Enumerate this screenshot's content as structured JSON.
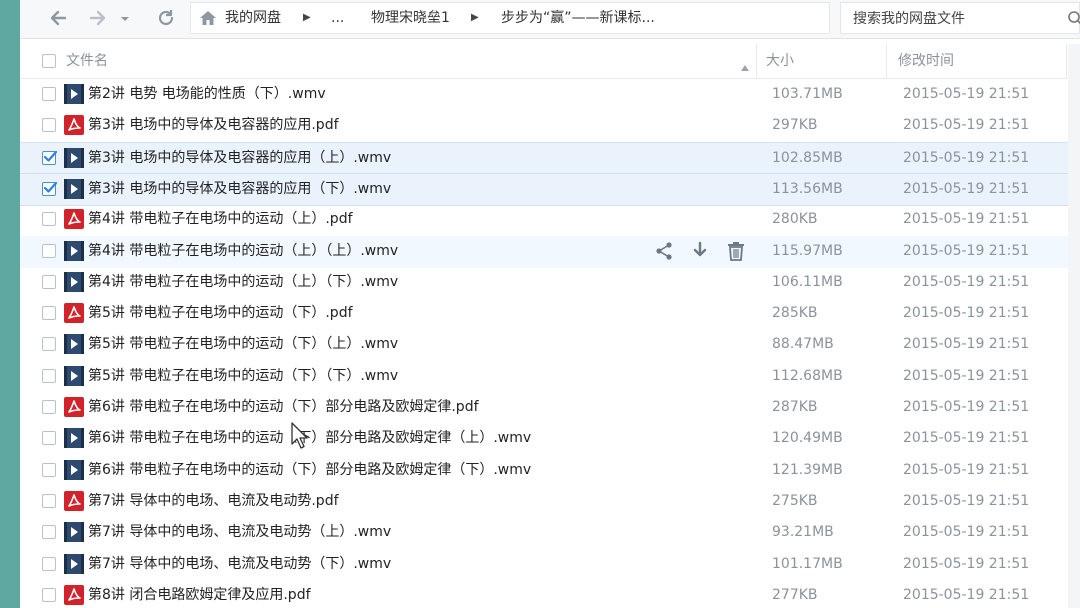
{
  "toolbar": {
    "breadcrumbs": [
      "我的网盘",
      "...",
      "物理宋晓垒1",
      "步步为“赢”——新课标..."
    ],
    "search_placeholder": "搜索我的网盘文件"
  },
  "columns": {
    "name": "文件名",
    "size": "大小",
    "modified": "修改时间"
  },
  "files": [
    {
      "type": "wmv",
      "name": "第2讲 电势  电场能的性质（下）.wmv",
      "size": "103.71MB",
      "date": "2015-05-19 21:51",
      "checked": false
    },
    {
      "type": "pdf",
      "name": "第3讲 电场中的导体及电容器的应用.pdf",
      "size": "297KB",
      "date": "2015-05-19 21:51",
      "checked": false
    },
    {
      "type": "wmv",
      "name": "第3讲 电场中的导体及电容器的应用（上）.wmv",
      "size": "102.85MB",
      "date": "2015-05-19 21:51",
      "checked": true
    },
    {
      "type": "wmv",
      "name": "第3讲 电场中的导体及电容器的应用（下）.wmv",
      "size": "113.56MB",
      "date": "2015-05-19 21:51",
      "checked": true
    },
    {
      "type": "pdf",
      "name": "第4讲 带电粒子在电场中的运动（上）.pdf",
      "size": "280KB",
      "date": "2015-05-19 21:51",
      "checked": false
    },
    {
      "type": "wmv",
      "name": "第4讲 带电粒子在电场中的运动（上）（上）.wmv",
      "size": "115.97MB",
      "date": "2015-05-19 21:51",
      "checked": false,
      "hover": true
    },
    {
      "type": "wmv",
      "name": "第4讲 带电粒子在电场中的运动（上）（下）.wmv",
      "size": "106.11MB",
      "date": "2015-05-19 21:51",
      "checked": false
    },
    {
      "type": "pdf",
      "name": "第5讲 带电粒子在电场中的运动（下）.pdf",
      "size": "285KB",
      "date": "2015-05-19 21:51",
      "checked": false
    },
    {
      "type": "wmv",
      "name": "第5讲 带电粒子在电场中的运动（下）（上）.wmv",
      "size": "88.47MB",
      "date": "2015-05-19 21:51",
      "checked": false
    },
    {
      "type": "wmv",
      "name": "第5讲 带电粒子在电场中的运动（下）（下）.wmv",
      "size": "112.68MB",
      "date": "2015-05-19 21:51",
      "checked": false
    },
    {
      "type": "pdf",
      "name": "第6讲 带电粒子在电场中的运动（下）部分电路及欧姆定律.pdf",
      "size": "287KB",
      "date": "2015-05-19 21:51",
      "checked": false
    },
    {
      "type": "wmv",
      "name": "第6讲 带电粒子在电场中的运动（下）部分电路及欧姆定律（上）.wmv",
      "size": "120.49MB",
      "date": "2015-05-19 21:51",
      "checked": false
    },
    {
      "type": "wmv",
      "name": "第6讲 带电粒子在电场中的运动（下）部分电路及欧姆定律（下）.wmv",
      "size": "121.39MB",
      "date": "2015-05-19 21:51",
      "checked": false
    },
    {
      "type": "pdf",
      "name": "第7讲 导体中的电场、电流及电动势.pdf",
      "size": "275KB",
      "date": "2015-05-19 21:51",
      "checked": false
    },
    {
      "type": "wmv",
      "name": "第7讲 导体中的电场、电流及电动势（上）.wmv",
      "size": "93.21MB",
      "date": "2015-05-19 21:51",
      "checked": false
    },
    {
      "type": "wmv",
      "name": "第7讲 导体中的电场、电流及电动势（下）.wmv",
      "size": "101.17MB",
      "date": "2015-05-19 21:51",
      "checked": false
    },
    {
      "type": "pdf",
      "name": "第8讲 闭合电路欧姆定律及应用.pdf",
      "size": "277KB",
      "date": "2015-05-19 21:51",
      "checked": false
    }
  ],
  "icons": {
    "back": "arrow-left-icon",
    "forward": "arrow-right-icon",
    "dropdown": "chevron-down-icon",
    "refresh": "refresh-icon",
    "home": "home-icon",
    "search": "search-icon",
    "share": "share-icon",
    "download": "download-icon",
    "delete": "trash-icon",
    "video": "video-file-icon",
    "pdf": "pdf-file-icon"
  },
  "colors": {
    "selected_bg": "#eaf3fc",
    "hover_bg": "#f2f8ff",
    "pdf_red": "#d2232a",
    "video_blue": "#2e4a6e",
    "accent": "#4a90d9"
  }
}
